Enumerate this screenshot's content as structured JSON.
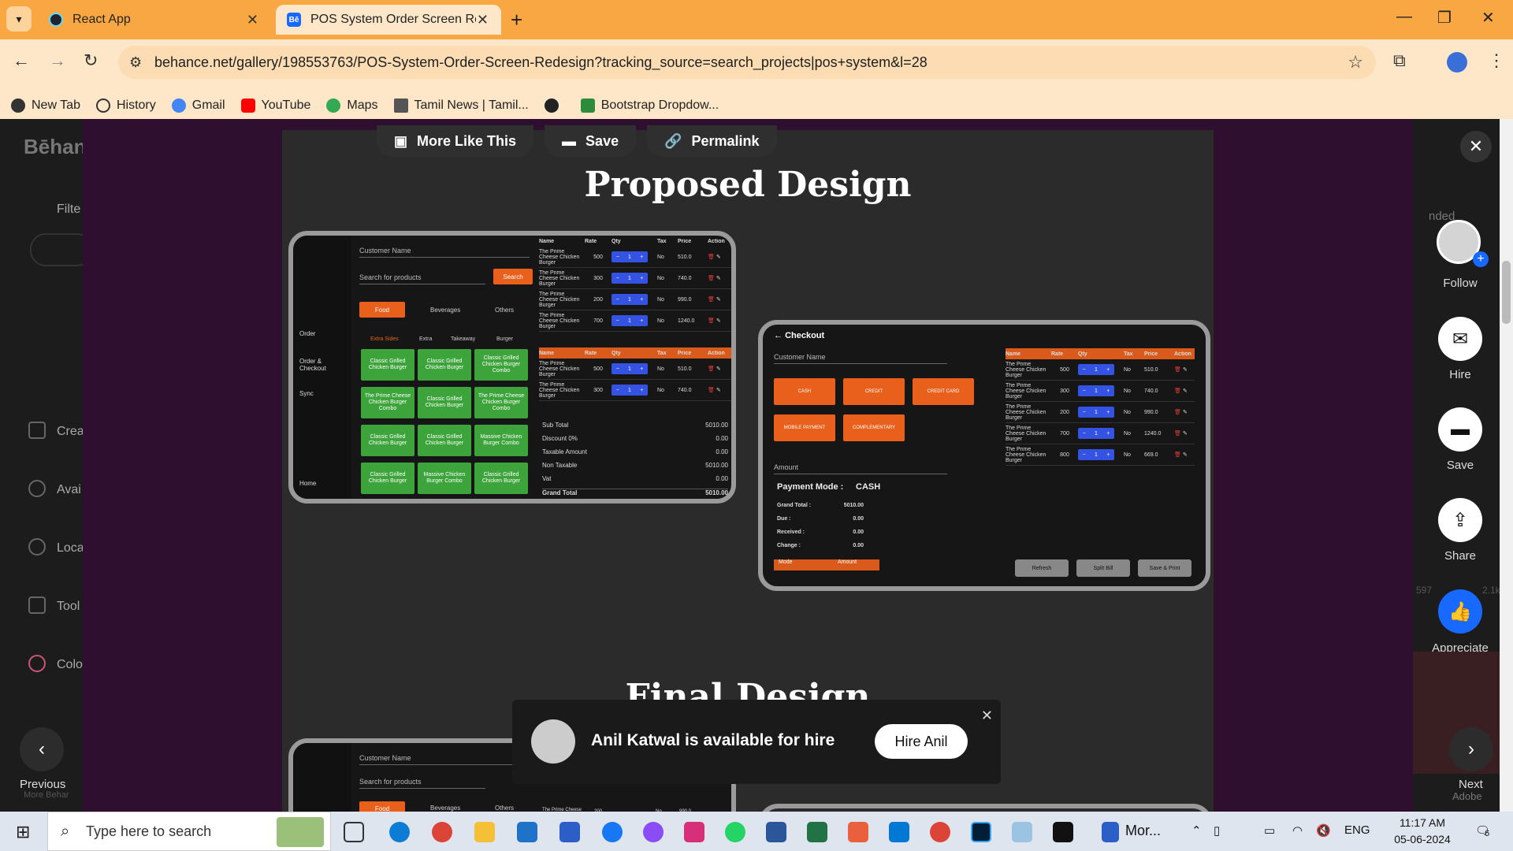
{
  "browser": {
    "tabs": [
      {
        "label": "React App",
        "active": false
      },
      {
        "label": "POS System Order Screen Rede",
        "active": true
      }
    ],
    "url": "behance.net/gallery/198553763/POS-System-Order-Screen-Redesign?tracking_source=search_projects|pos+system&l=28",
    "bookmarks": [
      "New Tab",
      "History",
      "Gmail",
      "YouTube",
      "Maps",
      "Tamil News | Tamil...",
      "",
      "Bootstrap Dropdow..."
    ]
  },
  "page": {
    "top_buttons": [
      "More Like This",
      "Save",
      "Permalink"
    ],
    "left_labels": {
      "logo": "Bēhan",
      "filter": "Filte",
      "creat": "Crea",
      "avail": "Avai",
      "loca": "Loca",
      "tools": "Tool",
      "colo": "Colo",
      "more": "More Behar"
    },
    "right_actions": {
      "follow": "Follow",
      "hire": "Hire",
      "save": "Save",
      "share": "Share",
      "appreciate": "Appreciate",
      "bg_num1": "597",
      "bg_num2": "2.1k",
      "bg_text": "nded"
    },
    "headings": {
      "proposed": "Proposed Design",
      "final": "Final Design"
    },
    "nav": {
      "previous": "Previous",
      "next": "Next",
      "adobe": "Adobe"
    },
    "hire_bar": {
      "text": "Anil Katwal is available for hire",
      "button": "Hire Anil"
    }
  },
  "pos": {
    "customer_name": "Customer Name",
    "search_placeholder": "Search for products",
    "search_btn": "Search",
    "cats": [
      "Food",
      "Beverages",
      "Others"
    ],
    "subtabs": [
      "Extra Sides",
      "Extra",
      "Takeaway",
      "Burger"
    ],
    "side": [
      "Order",
      "Order & Checkout",
      "Sync",
      "Home"
    ],
    "grid": [
      "Classic Grilled Chicken Burger",
      "Classic Grilled Chicken Burger",
      "Classic Grilled Chicken Burger Combo",
      "The Prime Cheese Chicken Burger Combo",
      "Classic Grilled Chicken Burger",
      "The Prime Cheese Chicken Burger Combo",
      "Classic Grilled Chicken Burger",
      "Classic Grilled Chicken Burger",
      "Massive Chicken Burger Combo",
      "Classic Grilled Chicken Burger",
      "Massive Chicken Burger Combo",
      "Classic Grilled Chicken Burger"
    ],
    "headers": [
      "Name",
      "Rate",
      "Qty",
      "Tax",
      "Price",
      "Action"
    ],
    "rows_top": [
      [
        "The Prime Cheese Chicken Burger",
        "500",
        "No",
        "510.0"
      ],
      [
        "The Prime Cheese Chicken Burger",
        "300",
        "No",
        "740.0"
      ],
      [
        "The Prime Cheese Chicken Burger",
        "200",
        "No",
        "990.0"
      ],
      [
        "The Prime Cheese Chicken Burger",
        "700",
        "No",
        "1240.0"
      ]
    ],
    "rows_mid": [
      [
        "The Prime Cheese Chicken Burger",
        "500",
        "No",
        "510.0"
      ],
      [
        "The Prime Cheese Chicken Burger",
        "300",
        "No",
        "740.0"
      ]
    ],
    "summary": [
      [
        "Sub Total",
        "5010.00"
      ],
      [
        "Discount   0%",
        "0.00"
      ],
      [
        "Taxable Amount",
        "0.00"
      ],
      [
        "Non Taxable",
        "5010.00"
      ],
      [
        "Vat",
        "0.00"
      ],
      [
        "Grand Total",
        "5010.00"
      ]
    ],
    "qty_val": "1"
  },
  "checkout": {
    "title": "Checkout",
    "customer_name": "Customer Name",
    "pay_buttons": [
      "CASH",
      "CREDIT",
      "CREDIT CARD",
      "MOBILE PAYMENT",
      "COMPLEMENTARY"
    ],
    "amount": "Amount",
    "payment_mode_label": "Payment Mode :",
    "payment_mode_value": "CASH",
    "totals": [
      [
        "Grand Total :",
        "5010.00"
      ],
      [
        "Due :",
        "0.00"
      ],
      [
        "Received :",
        "0.00"
      ],
      [
        "Change :",
        "0.00"
      ]
    ],
    "mode_headers": [
      "Mode",
      "Amount"
    ],
    "rows": [
      [
        "The Prime Cheese Chicken Burger",
        "500",
        "No",
        "510.0"
      ],
      [
        "The Prime Cheese Chicken Burger",
        "300",
        "No",
        "740.0"
      ],
      [
        "The Prime Cheese Chicken Burger",
        "200",
        "No",
        "990.0"
      ],
      [
        "The Prime Cheese Chicken Burger",
        "700",
        "No",
        "1240.0"
      ],
      [
        "The Prime Cheese Chicken Burger",
        "800",
        "No",
        "669.0"
      ]
    ],
    "buttons": [
      "Refresh",
      "Split Bill",
      "Save & Print"
    ]
  },
  "final_preview": {
    "customer_name": "Customer Name",
    "search_placeholder": "Search for products",
    "row": [
      "The Prime Cheese Chicken Burger",
      "200",
      "No",
      "990.0"
    ]
  },
  "taskbar": {
    "search_placeholder": "Type here to search",
    "more_label": "Mor...",
    "lang": "ENG",
    "time": "11:17 AM",
    "date": "05-06-2024",
    "notif": "6"
  }
}
